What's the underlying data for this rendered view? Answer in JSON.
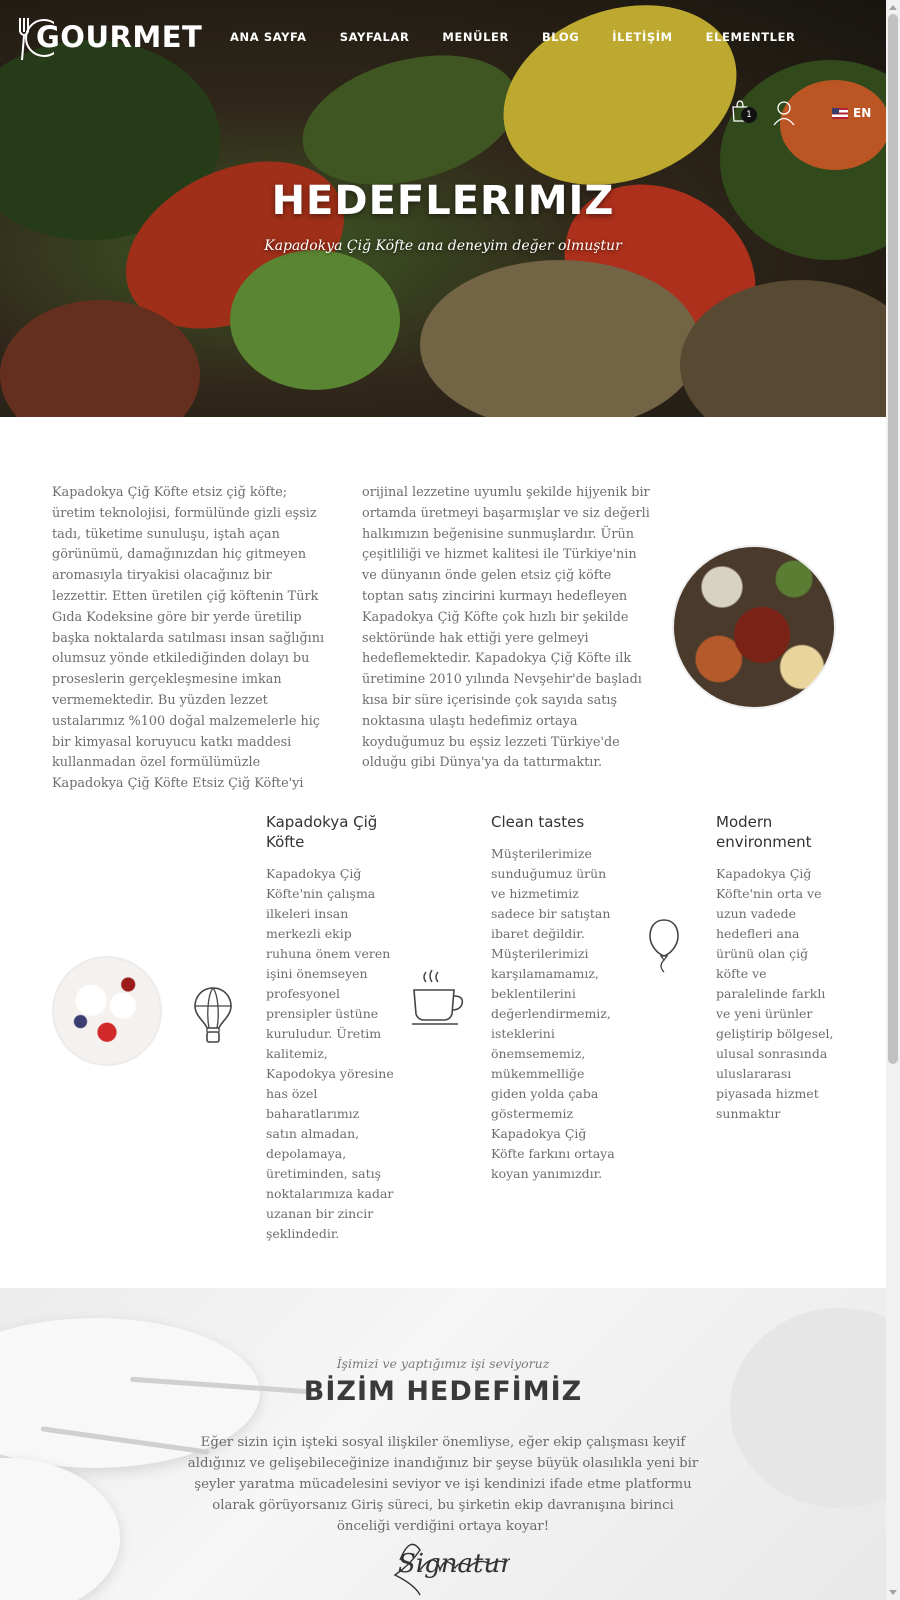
{
  "brand": {
    "logo_text": "GOURMET"
  },
  "nav": {
    "items": [
      "ANA SAYFA",
      "SAYFALAR",
      "MENÜLER",
      "BLOG",
      "İLETİŞİM",
      "ELEMENTLER"
    ]
  },
  "header": {
    "cart_count": "1",
    "language": "EN"
  },
  "hero": {
    "title": "HEDEFLERIMIZ",
    "subtitle": "Kapadokya Çiğ Köfte ana deneyim değer olmuştur"
  },
  "intro": {
    "col1": "Kapadokya Çiğ Köfte etsiz çiğ köfte; üretim teknolojisi, formülünde gizli eşsiz tadı, tüketime sunuluşu, iştah açan görünümü, damağınızdan hiç gitmeyen aromasıyla tiryakisi olacağınız bir lezzettir. Etten üretilen çiğ köftenin Türk Gıda Kodeksine göre bir yerde üretilip başka noktalarda satılması insan sağlığını olumsuz yönde etkilediğinden dolayı bu proseslerin gerçekleşmesine imkan vermemektedir. Bu yüzden lezzet ustalarımız %100 doğal malzemelerle hiç bir kimyasal koruyucu katkı maddesi kullanmadan özel formülümüzle Kapadokya Çiğ Köfte Etsiz Çiğ Köfte'yi",
    "col2": "orijinal lezzetine uyumlu şekilde hijyenik bir ortamda üretmeyi başarmışlar ve siz değerli halkımızın beğenisine sunmuşlardır. Ürün çeşitliliği ve hizmet kalitesi ile Türkiye'nin ve dünyanın önde gelen etsiz çiğ köfte toptan satış zincirini kurmayı hedefleyen Kapadokya Çiğ Köfte çok hızlı bir şekilde sektöründe hak ettiği yere gelmeyi hedeflemektedir. Kapadokya Çiğ Köfte ilk üretimine 2010 yılında Nevşehir'de başladı kısa bir süre içerisinde çok sayıda satış noktasına ulaştı hedefimiz ortaya koyduğumuz bu eşsiz lezzeti Türkiye'de olduğu gibi Dünya'ya da tattırmaktır."
  },
  "features": [
    {
      "title": "Kapadokya Çiğ Köfte",
      "icon": "hot-air-balloon-icon",
      "text": "Kapadokya Çiğ Köfte'nin çalışma ilkeleri insan merkezli ekip ruhuna önem veren işini önemseyen profesyonel prensipler üstüne kuruludur. Üretim kalitemiz, Kapodokya yöresine has özel baharatlarımız satın almadan, depolamaya, üretiminden, satış noktalarımıza kadar uzanan bir zincir şeklindedir."
    },
    {
      "title": "Clean tastes",
      "icon": "coffee-cup-icon",
      "text": "Müşterilerimize sunduğumuz ürün ve hizmetimiz sadece bir satıştan ibaret değildir. Müşterilerimizi karşılamamamız, beklentilerini değerlendirmemiz, isteklerini önemsememiz, mükemmelliğe giden yolda çaba göstermemiz Kapadokya Çiğ Köfte farkını ortaya koyan yanımızdır."
    },
    {
      "title": "Modern environment",
      "icon": "balloon-icon",
      "text": "Kapadokya Çiğ Köfte'nin orta ve uzun vadede hedefleri ana ürünü olan çiğ köfte ve paralelinde farklı ve yeni ürünler geliştirip bölgesel, ulusal sonrasında uluslararası piyasada hizmet sunmaktır"
    }
  ],
  "goal": {
    "kicker": "İşimizi ve yaptığımız işi seviyoruz",
    "title": "BİZİM HEDEFİMİZ",
    "text": "Eğer sizin için işteki sosyal ilişkiler önemliyse, eğer ekip çalışması keyif aldığınız ve gelişebileceğinize inandığınız bir şeyse büyük olasılıkla yeni bir şeyler yaratma mücadelesini seviyor ve işi kendinizi ifade etme platformu olarak görüyorsanız Giriş süreci, bu şirketin ekip davranışına birinci önceliği verdiğini ortaya koyar!",
    "signature": "Signature"
  }
}
